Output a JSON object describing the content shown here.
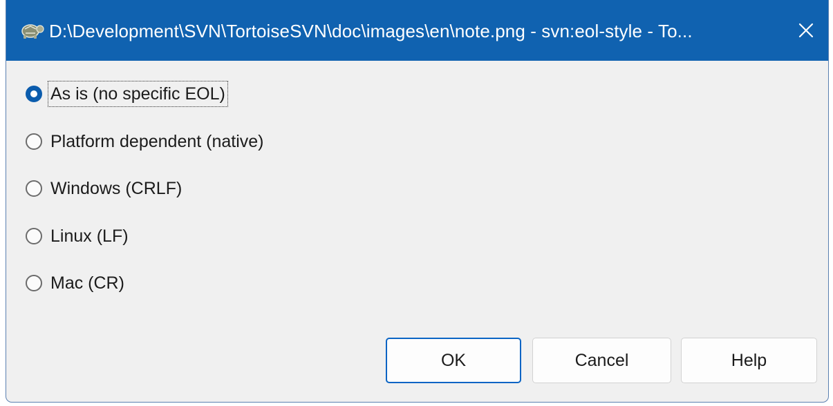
{
  "window": {
    "title": "D:\\Development\\SVN\\TortoiseSVN\\doc\\images\\en\\note.png - svn:eol-style - To...",
    "icon": "tortoise-icon",
    "close_icon": "close-icon",
    "titlebar_color": "#1062b0"
  },
  "options": [
    {
      "label": "As is (no specific EOL)",
      "checked": true
    },
    {
      "label": "Platform dependent (native)",
      "checked": false
    },
    {
      "label": "Windows (CRLF)",
      "checked": false
    },
    {
      "label": "Linux (LF)",
      "checked": false
    },
    {
      "label": "Mac (CR)",
      "checked": false
    }
  ],
  "buttons": {
    "ok": "OK",
    "cancel": "Cancel",
    "help": "Help"
  },
  "colors": {
    "accent": "#0b5cad",
    "dialog_bg": "#f0f0f0"
  }
}
